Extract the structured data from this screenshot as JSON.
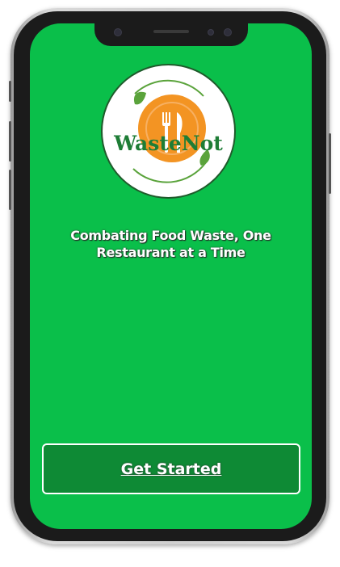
{
  "logo": {
    "brand_name": "WasteNot",
    "icon": "plate-fork-knife-icon"
  },
  "tagline": "Combating Food Waste, One Restaurant at a Time",
  "cta": {
    "label": "Get Started"
  },
  "colors": {
    "screen_background": "#0abf4a",
    "button_background": "#0e8a35",
    "brand_text": "#1e7d36",
    "plate_orange": "#f39423"
  }
}
